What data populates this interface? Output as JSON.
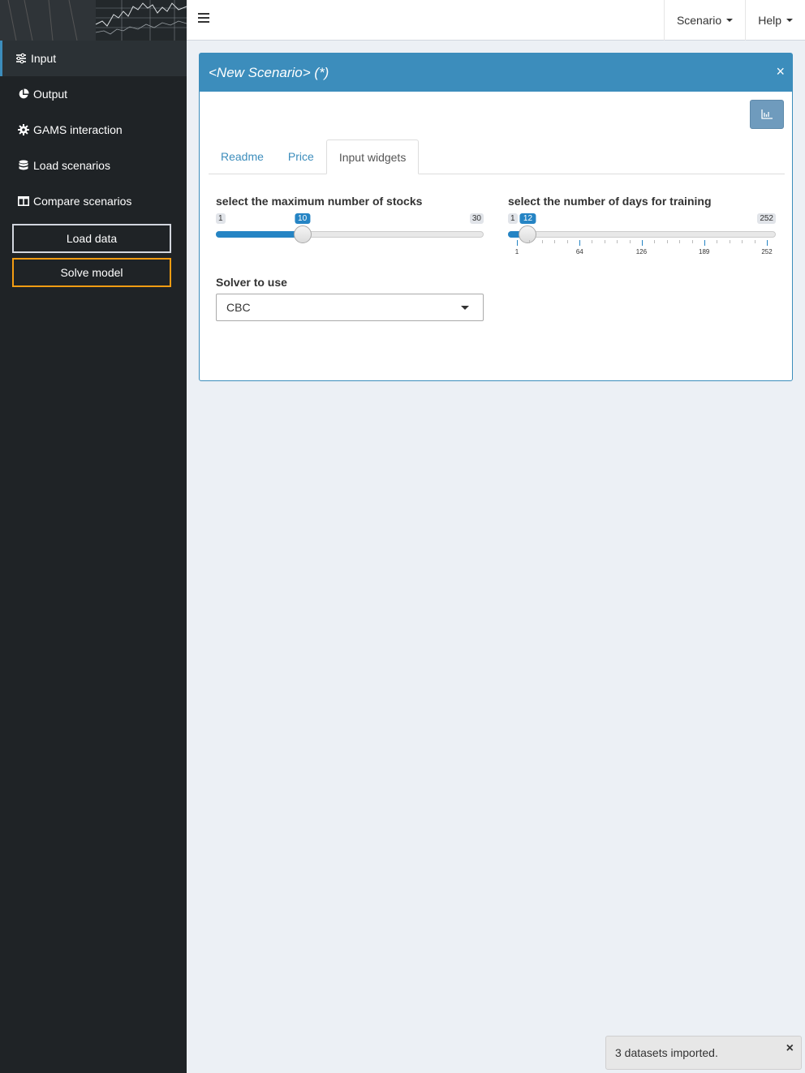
{
  "sidebar": {
    "items": [
      {
        "label": "Input",
        "icon": "sliders-icon",
        "active": true
      },
      {
        "label": "Output",
        "icon": "pie-chart-icon",
        "active": false
      },
      {
        "label": "GAMS interaction",
        "icon": "gear-icon",
        "active": false
      },
      {
        "label": "Load scenarios",
        "icon": "database-icon",
        "active": false
      },
      {
        "label": "Compare scenarios",
        "icon": "columns-icon",
        "active": false
      }
    ],
    "load_data_label": "Load data",
    "solve_model_label": "Solve model"
  },
  "topbar": {
    "scenario_label": "Scenario",
    "help_label": "Help"
  },
  "box": {
    "title": "<New Scenario> (*)",
    "close_glyph": "×",
    "tabs": [
      {
        "label": "Readme",
        "active": false
      },
      {
        "label": "Price",
        "active": false
      },
      {
        "label": "Input widgets",
        "active": true
      }
    ]
  },
  "widgets": {
    "stocks_slider": {
      "label": "select the maximum number of stocks",
      "min": 1,
      "max": 30,
      "value": 10,
      "min_label": "1",
      "max_label": "30",
      "value_label": "10"
    },
    "days_slider": {
      "label": "select the number of days for training",
      "min": 1,
      "max": 252,
      "value": 12,
      "min_label": "1",
      "max_label": "252",
      "value_label": "12",
      "tick_labels": [
        "1",
        "64",
        "126",
        "189",
        "252"
      ],
      "tick_values": [
        1,
        64,
        126,
        189,
        252
      ]
    },
    "solver": {
      "label": "Solver to use",
      "selected": "CBC"
    }
  },
  "notification": {
    "text": "3 datasets imported.",
    "close_glyph": "×"
  },
  "colors": {
    "accent": "#3c8dbc",
    "slider": "#2584c4",
    "sidebar": "#1f2326",
    "solve_border": "#f39c12",
    "background": "#ecf0f5"
  }
}
